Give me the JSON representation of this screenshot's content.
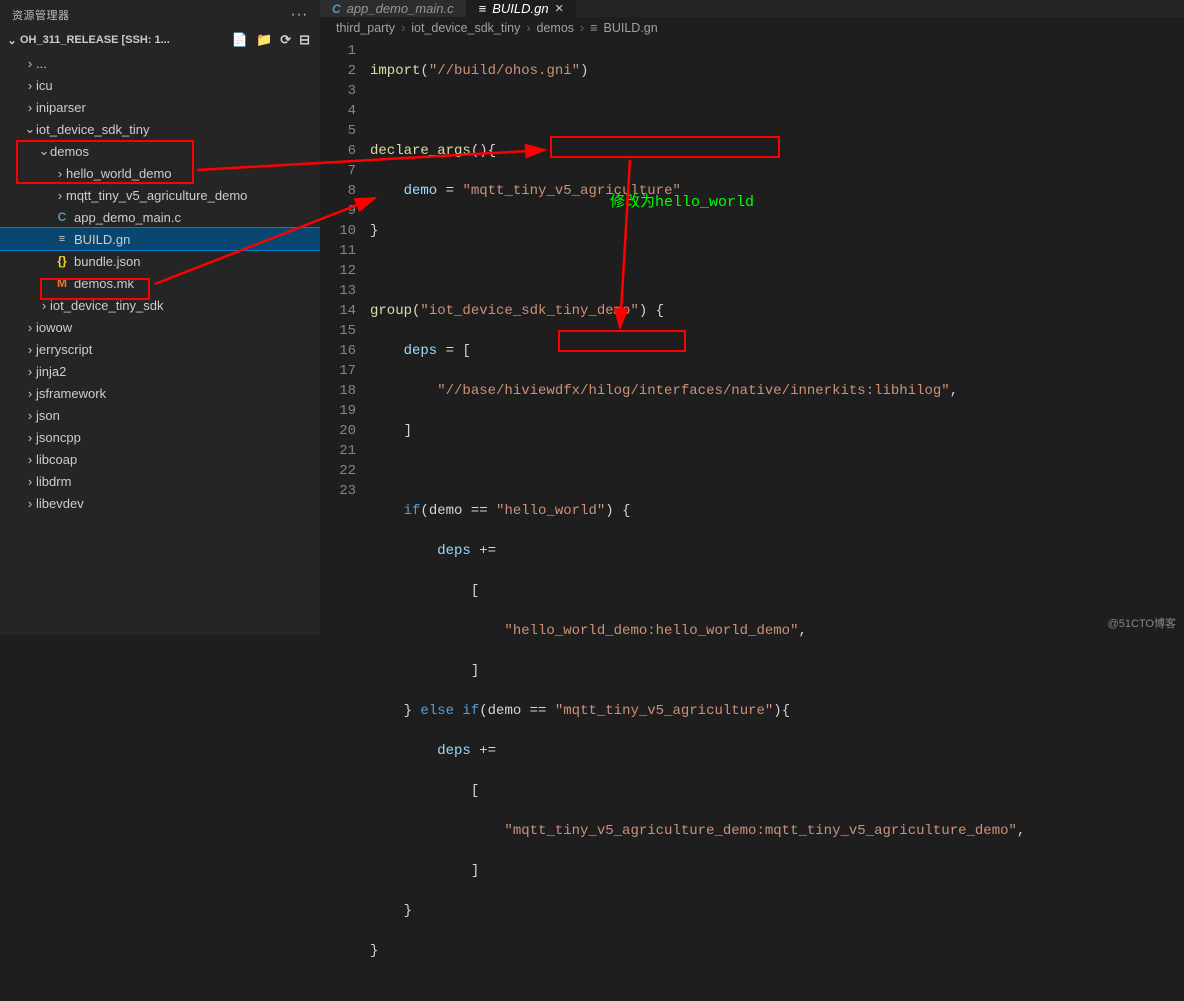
{
  "sidebar": {
    "title": "资源管理器",
    "workspace": "OH_311_RELEASE [SSH: 1...",
    "tree": {
      "item0": "...",
      "item1": "icu",
      "item2": "iniparser",
      "item3": "iot_device_sdk_tiny",
      "item4": "demos",
      "item5": "hello_world_demo",
      "item6": "mqtt_tiny_v5_agriculture_demo",
      "item7": "app_demo_main.c",
      "item8": "BUILD.gn",
      "item9": "bundle.json",
      "item10": "demos.mk",
      "item11": "iot_device_tiny_sdk",
      "item12": "iowow",
      "item13": "jerryscript",
      "item14": "jinja2",
      "item15": "jsframework",
      "item16": "json",
      "item17": "jsoncpp",
      "item18": "libcoap",
      "item19": "libdrm",
      "item20": "libevdev"
    }
  },
  "tabs": {
    "tab1": {
      "icon": "C",
      "label": "app_demo_main.c"
    },
    "tab2": {
      "icon": "≡",
      "label": "BUILD.gn"
    }
  },
  "breadcrumbs": {
    "p1": "third_party",
    "p2": "iot_device_sdk_tiny",
    "p3": "demos",
    "p4": "BUILD.gn"
  },
  "code": {
    "l1a": "import",
    "l1b": "(",
    "l1c": "\"//build/ohos.gni\"",
    "l1d": ")",
    "l3a": "declare_args",
    "l3b": "(){",
    "l4a": "    demo",
    "l4b": " = ",
    "l4c": "\"mqtt_tiny_v5_agriculture\"",
    "l5a": "}",
    "l7a": "group",
    "l7b": "(",
    "l7c": "\"iot_device_sdk_tiny_demo\"",
    "l7d": ") {",
    "l8a": "    deps",
    "l8b": " = [",
    "l9a": "        ",
    "l9b": "\"//base/hiviewdfx/hilog/interfaces/native/innerkits:libhilog\"",
    "l9c": ",",
    "l10a": "    ]",
    "l12a": "    ",
    "l12b": "if",
    "l12c": "(demo == ",
    "l12d": "\"hello_world\"",
    "l12e": ") {",
    "l13a": "        deps",
    "l13b": " +=",
    "l14a": "            [",
    "l15a": "                ",
    "l15b": "\"hello_world_demo:hello_world_demo\"",
    "l15c": ",",
    "l16a": "            ]",
    "l17a": "    } ",
    "l17b": "else if",
    "l17c": "(demo == ",
    "l17d": "\"mqtt_tiny_v5_agriculture\"",
    "l17e": "){",
    "l18a": "        deps",
    "l18b": " +=",
    "l19a": "            [",
    "l20a": "                ",
    "l20b": "\"mqtt_tiny_v5_agriculture_demo:mqtt_tiny_v5_agriculture_demo\"",
    "l20c": ",",
    "l21a": "            ]",
    "l22a": "    }",
    "l23a": "}"
  },
  "line_numbers": [
    "1",
    "2",
    "3",
    "4",
    "5",
    "6",
    "7",
    "8",
    "9",
    "10",
    "11",
    "12",
    "13",
    "14",
    "15",
    "16",
    "17",
    "18",
    "19",
    "20",
    "21",
    "22",
    "23"
  ],
  "annotation": "修改为hello_world",
  "watermark": "@51CTO博客",
  "colors": {
    "red": "#ff0000",
    "green": "#00ff00",
    "editor_bg": "#1e1e1e",
    "sidebar_bg": "#252526",
    "selection": "#094771"
  }
}
